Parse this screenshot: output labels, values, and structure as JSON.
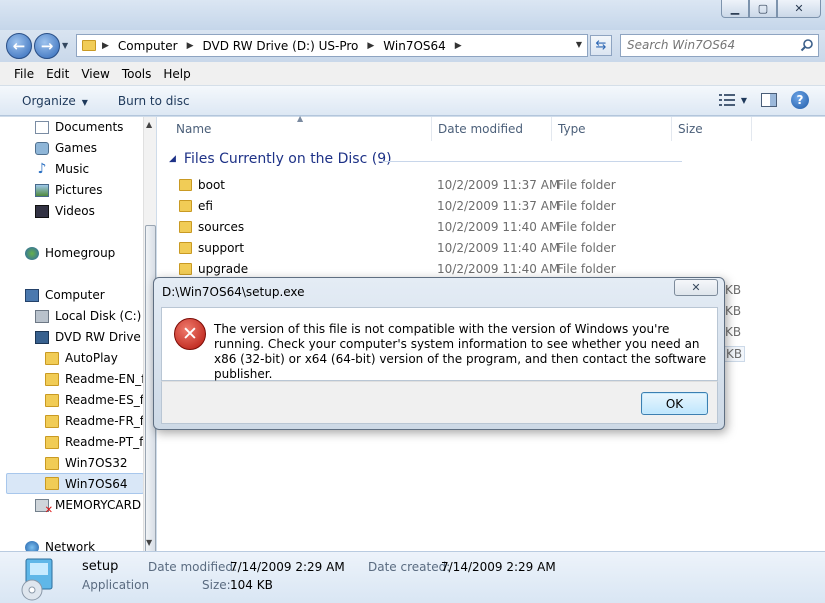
{
  "nav": {
    "breadcrumbs": [
      "Computer",
      "DVD RW Drive (D:) US-Pro",
      "Win7OS64"
    ],
    "search_placeholder": "Search Win7OS64"
  },
  "menu": [
    "File",
    "Edit",
    "View",
    "Tools",
    "Help"
  ],
  "commands": {
    "organize": "Organize",
    "burn": "Burn to disc"
  },
  "sidebar": [
    {
      "label": "Documents",
      "icon": "documents-icon"
    },
    {
      "label": "Games",
      "icon": "games-icon"
    },
    {
      "label": "Music",
      "icon": "music-icon"
    },
    {
      "label": "Pictures",
      "icon": "pictures-icon"
    },
    {
      "label": "Videos",
      "icon": "videos-icon"
    },
    {
      "label": "Homegroup",
      "icon": "homegroup-icon"
    },
    {
      "label": "Computer",
      "icon": "computer-icon"
    },
    {
      "label": "Local Disk (C:)",
      "icon": "local-disk-icon"
    },
    {
      "label": "DVD RW Drive (D",
      "icon": "dvd-drive-icon"
    },
    {
      "label": "AutoPlay",
      "icon": "folder-icon"
    },
    {
      "label": "Readme-EN_fi",
      "icon": "folder-icon"
    },
    {
      "label": "Readme-ES_fil",
      "icon": "folder-icon"
    },
    {
      "label": "Readme-FR_fil",
      "icon": "folder-icon"
    },
    {
      "label": "Readme-PT_fi",
      "icon": "folder-icon"
    },
    {
      "label": "Win7OS32",
      "icon": "folder-icon"
    },
    {
      "label": "Win7OS64",
      "icon": "folder-icon",
      "selected": true
    },
    {
      "label": "MEMORYCARD",
      "icon": "memory-card-icon"
    },
    {
      "label": "Network",
      "icon": "network-icon"
    }
  ],
  "columns": {
    "name": "Name",
    "date": "Date modified",
    "type": "Type",
    "size": "Size"
  },
  "group_title": "Files Currently on the Disc (9)",
  "files": [
    {
      "name": "boot",
      "date": "10/2/2009 11:37 AM",
      "type": "File folder"
    },
    {
      "name": "efi",
      "date": "10/2/2009 11:37 AM",
      "type": "File folder"
    },
    {
      "name": "sources",
      "date": "10/2/2009 11:40 AM",
      "type": "File folder"
    },
    {
      "name": "support",
      "date": "10/2/2009 11:40 AM",
      "type": "File folder"
    },
    {
      "name": "upgrade",
      "date": "10/2/2009 11:40 AM",
      "type": "File folder"
    }
  ],
  "hidden_sizes": [
    "KB",
    "KB",
    "KB",
    "KB"
  ],
  "details": {
    "name": "setup",
    "type": "Application",
    "date_modified_label": "Date modified:",
    "date_modified": "7/14/2009 2:29 AM",
    "date_created_label": "Date created:",
    "date_created": "7/14/2009 2:29 AM",
    "size_label": "Size:",
    "size": "104 KB"
  },
  "dialog": {
    "title": "D:\\Win7OS64\\setup.exe",
    "message": "The version of this file is not compatible with the version of Windows you're running. Check your computer's system information to see whether you need an x86 (32-bit) or x64 (64-bit) version of the program, and then contact the software publisher.",
    "ok_label": "OK",
    "close_glyph": "✕"
  }
}
